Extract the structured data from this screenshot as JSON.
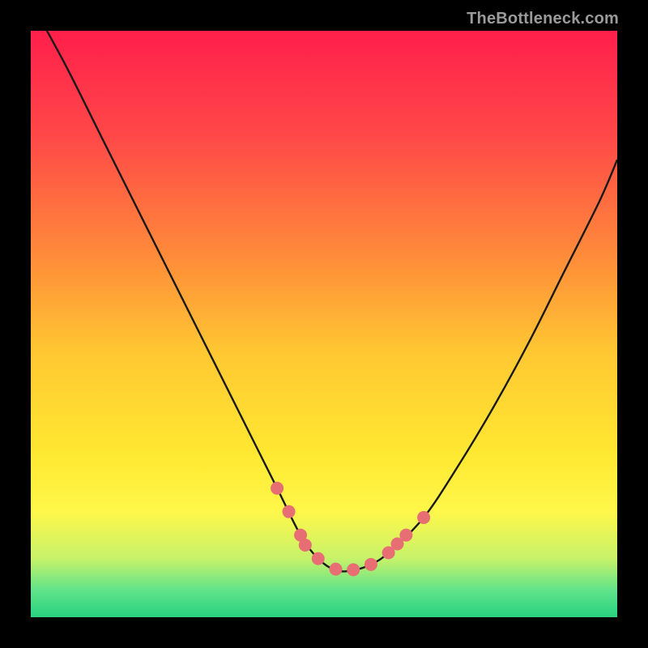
{
  "watermark": {
    "text": "TheBottleneck.com"
  },
  "colors": {
    "bg_black": "#000000",
    "curve": "#1a1a1a",
    "marker": "#e76f73",
    "gradient_stops": [
      {
        "offset": 0.0,
        "color": "#ff1f4b"
      },
      {
        "offset": 0.18,
        "color": "#ff4848"
      },
      {
        "offset": 0.38,
        "color": "#ff8a3a"
      },
      {
        "offset": 0.55,
        "color": "#ffc832"
      },
      {
        "offset": 0.72,
        "color": "#ffe831"
      },
      {
        "offset": 0.82,
        "color": "#fff74a"
      },
      {
        "offset": 0.9,
        "color": "#c6f26a"
      },
      {
        "offset": 0.955,
        "color": "#5fe38a"
      },
      {
        "offset": 1.0,
        "color": "#28d17f"
      }
    ]
  },
  "chart_data": {
    "type": "line",
    "title": "",
    "xlabel": "",
    "ylabel": "",
    "xlim": [
      0,
      100
    ],
    "ylim": [
      0,
      100
    ],
    "series": [
      {
        "name": "bottleneck-curve",
        "x": [
          0,
          6,
          12,
          18,
          24,
          30,
          36,
          42,
          46,
          49,
          52,
          55,
          58,
          61,
          67,
          73,
          79,
          85,
          91,
          97,
          100
        ],
        "values": [
          105,
          94,
          82,
          70,
          58,
          46,
          34,
          22,
          14,
          10,
          8,
          8,
          9,
          11,
          17,
          26,
          36,
          47,
          59,
          71,
          78
        ]
      }
    ],
    "markers": [
      {
        "x": 42.0,
        "y": 22.0
      },
      {
        "x": 44.0,
        "y": 18.0
      },
      {
        "x": 46.0,
        "y": 14.0
      },
      {
        "x": 46.8,
        "y": 12.3
      },
      {
        "x": 49.0,
        "y": 10.0
      },
      {
        "x": 52.0,
        "y": 8.2
      },
      {
        "x": 55.0,
        "y": 8.1
      },
      {
        "x": 58.0,
        "y": 9.0
      },
      {
        "x": 61.0,
        "y": 11.0
      },
      {
        "x": 62.5,
        "y": 12.5
      },
      {
        "x": 64.0,
        "y": 14.0
      },
      {
        "x": 67.0,
        "y": 17.0
      }
    ]
  }
}
